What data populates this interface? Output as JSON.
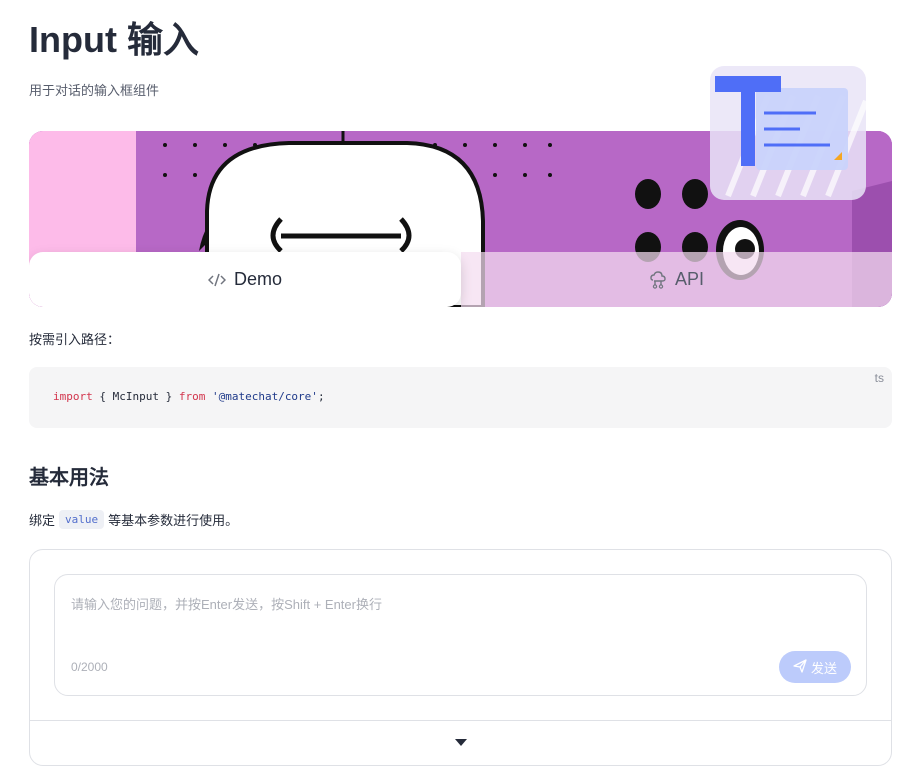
{
  "page": {
    "title": "Input 输入",
    "subtitle": "用于对话的输入框组件"
  },
  "tabs": [
    {
      "label": "Demo",
      "icon": "code-icon",
      "active": true
    },
    {
      "label": "API",
      "icon": "api-icon",
      "active": false
    }
  ],
  "import_section": {
    "intro": "按需引入路径：",
    "code_lang": "ts",
    "code": {
      "kw_import": "import",
      "brace_open": " { McInput } ",
      "kw_from": "from",
      "source": " '@matechat/core'",
      "semicolon": ";"
    }
  },
  "basic": {
    "heading": "基本用法",
    "desc_before": "绑定",
    "desc_code": "value",
    "desc_after": "等基本参数进行使用。"
  },
  "demo_input": {
    "placeholder": "请输入您的问题，并按Enter发送，按Shift + Enter换行",
    "counter": "0/2000",
    "send_label": "发送",
    "send_icon": "send-icon",
    "toggle_icon": "caret-down-icon"
  },
  "colors": {
    "accent": "#5e7ce0",
    "send_disabled": "#bccbfb",
    "banner_purple": "#b565c4",
    "banner_pink": "#fdbbe9"
  }
}
